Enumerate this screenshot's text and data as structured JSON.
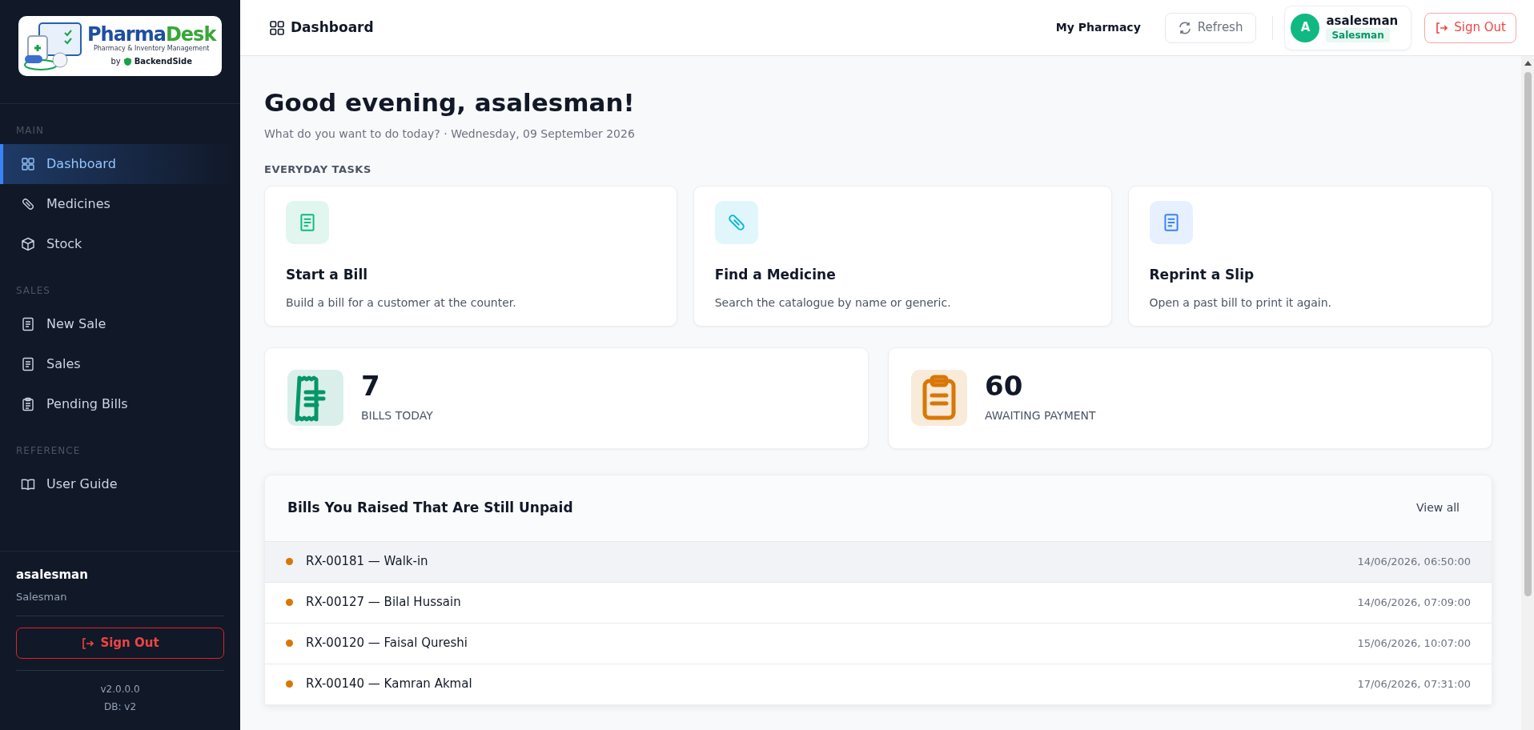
{
  "sidebar": {
    "sections": [
      {
        "label": "MAIN",
        "items": [
          {
            "label": "Dashboard",
            "selected": true
          },
          {
            "label": "Medicines",
            "selected": false
          },
          {
            "label": "Stock",
            "selected": false
          }
        ]
      },
      {
        "label": "SALES",
        "items": [
          {
            "label": "New Sale",
            "selected": false
          },
          {
            "label": "Sales",
            "selected": false
          },
          {
            "label": "Pending Bills",
            "selected": false
          }
        ]
      },
      {
        "label": "REFERENCE",
        "items": [
          {
            "label": "User Guide",
            "selected": false
          }
        ]
      }
    ],
    "user": {
      "name": "asalesman",
      "role": "Salesman"
    },
    "sign_out": "Sign Out",
    "version": "v2.0.0.0",
    "db": "DB: v2"
  },
  "logo": {
    "title_part1": "Pharma",
    "title_part2": "Desk",
    "subtitle": "Pharmacy & Inventory Management",
    "by": "by",
    "company": "BackendSide"
  },
  "topbar": {
    "title": "Dashboard",
    "pharmacy": "My Pharmacy",
    "refresh": "Refresh",
    "user": {
      "initial": "A",
      "name": "asalesman",
      "role": "Salesman"
    },
    "sign_out": "Sign Out"
  },
  "greeting": "Good evening, asalesman!",
  "subtitle": "What do you want to do today? · Wednesday, 09 September 2026",
  "tasks_heading": "EVERYDAY TASKS",
  "tasks": [
    {
      "title": "Start a Bill",
      "description": "Build a bill for a customer at the counter.",
      "color": "#10b981"
    },
    {
      "title": "Find a Medicine",
      "description": "Search the catalogue by name or generic.",
      "color": "#06b6d4"
    },
    {
      "title": "Reprint a Slip",
      "description": "Open a past bill to print it again.",
      "color": "#3b82f6"
    }
  ],
  "stats": [
    {
      "value": "7",
      "label": "BILLS TODAY",
      "color": "#059669"
    },
    {
      "value": "60",
      "label": "AWAITING PAYMENT",
      "color": "#d97706"
    }
  ],
  "unpaid": {
    "title": "Bills You Raised That Are Still Unpaid",
    "view_all": "View all",
    "rows": [
      {
        "bill": "RX-00181 — Walk-in",
        "time": "14/06/2026, 06:50:00",
        "color": "#d97706",
        "selected": true
      },
      {
        "bill": "RX-00127 — Bilal Hussain",
        "time": "14/06/2026, 07:09:00",
        "color": "#d97706",
        "selected": false
      },
      {
        "bill": "RX-00120 — Faisal Qureshi",
        "time": "15/06/2026, 10:07:00",
        "color": "#d97706",
        "selected": false
      },
      {
        "bill": "RX-00140 — Kamran Akmal",
        "time": "17/06/2026, 07:31:00",
        "color": "#d97706",
        "selected": false
      }
    ]
  }
}
